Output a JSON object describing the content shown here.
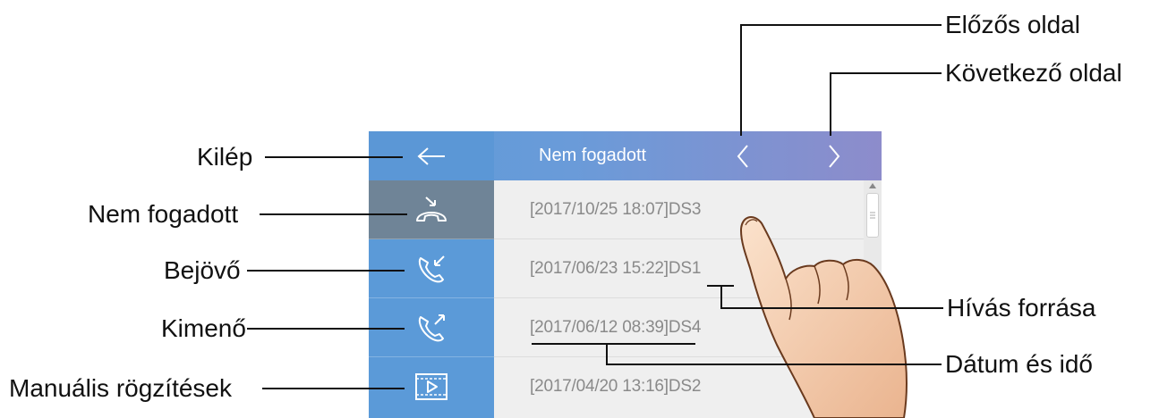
{
  "screen": {
    "title": "Nem fogadott",
    "sidebar": [
      {
        "icon": "missed-call-icon",
        "active": true
      },
      {
        "icon": "incoming-call-icon",
        "active": false
      },
      {
        "icon": "outgoing-call-icon",
        "active": false
      },
      {
        "icon": "video-record-icon",
        "active": false
      }
    ],
    "entries": [
      {
        "text": "[2017/10/25  18:07]DS3"
      },
      {
        "text": "[2017/06/23  15:22]DS1"
      },
      {
        "text": "[2017/06/12  08:39]DS4"
      },
      {
        "text": "[2017/04/20  13:16]DS2"
      }
    ]
  },
  "callouts": {
    "exit": "Kilép",
    "missed": "Nem fogadott",
    "incoming": "Bejövő",
    "outgoing": "Kimenő",
    "manual": "Manuális rögzítések",
    "prev_page": "Előzős oldal",
    "next_page": "Következő oldal",
    "source": "Hívás forrása",
    "datetime": "Dátum és idő"
  },
  "colors": {
    "sidebar": "#5b9ad8",
    "active_item": "#6f8497",
    "title_start": "#5d9bd8",
    "title_end": "#8d8ccb",
    "list_bg": "#efefef",
    "entry_text": "#8a8a8a"
  }
}
